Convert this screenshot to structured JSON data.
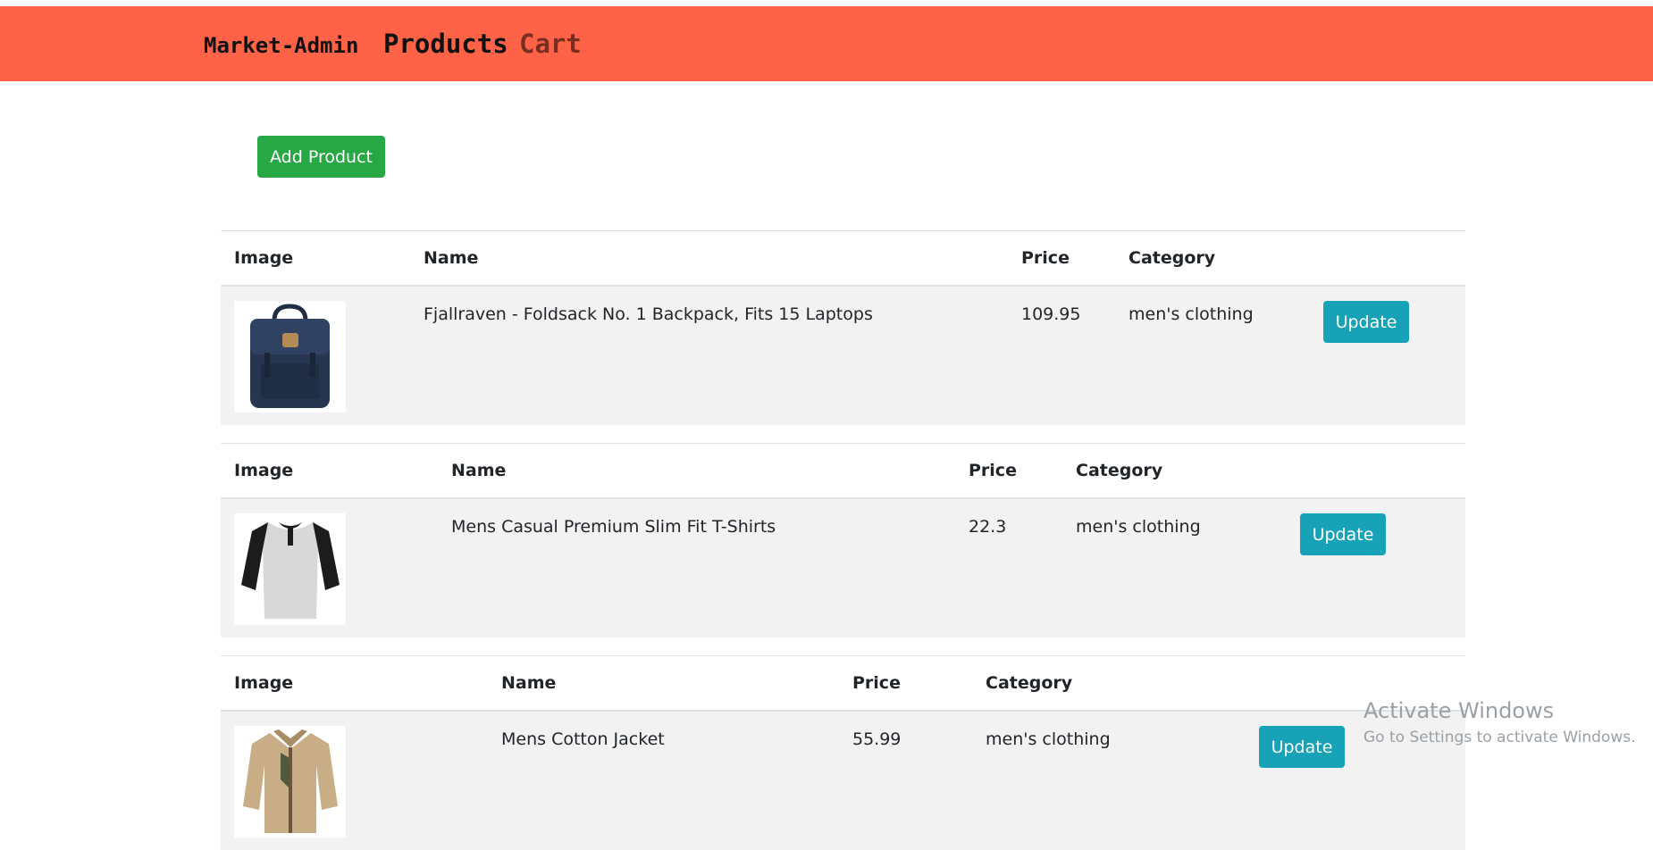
{
  "navbar": {
    "brand": "Market-Admin",
    "links": [
      "Products",
      "Cart"
    ],
    "bg_color": "#ff6347"
  },
  "actions": {
    "add_product_label": "Add Product",
    "add_product_color": "#28a745"
  },
  "table_headers": [
    "Image",
    "Name",
    "Price",
    "Category"
  ],
  "update_label": "Update",
  "update_color": "#17a2b8",
  "products": [
    {
      "image_icon": "backpack-image",
      "name": "Fjallraven - Foldsack No. 1 Backpack, Fits 15 Laptops",
      "price": "109.95",
      "category": "men's clothing"
    },
    {
      "image_icon": "tshirt-image",
      "name": "Mens Casual Premium Slim Fit T-Shirts",
      "price": "22.3",
      "category": "men's clothing"
    },
    {
      "image_icon": "jacket-image",
      "name": "Mens Cotton Jacket",
      "price": "55.99",
      "category": "men's clothing"
    }
  ],
  "watermark": {
    "title": "Activate Windows",
    "subtitle": "Go to Settings to activate Windows."
  }
}
